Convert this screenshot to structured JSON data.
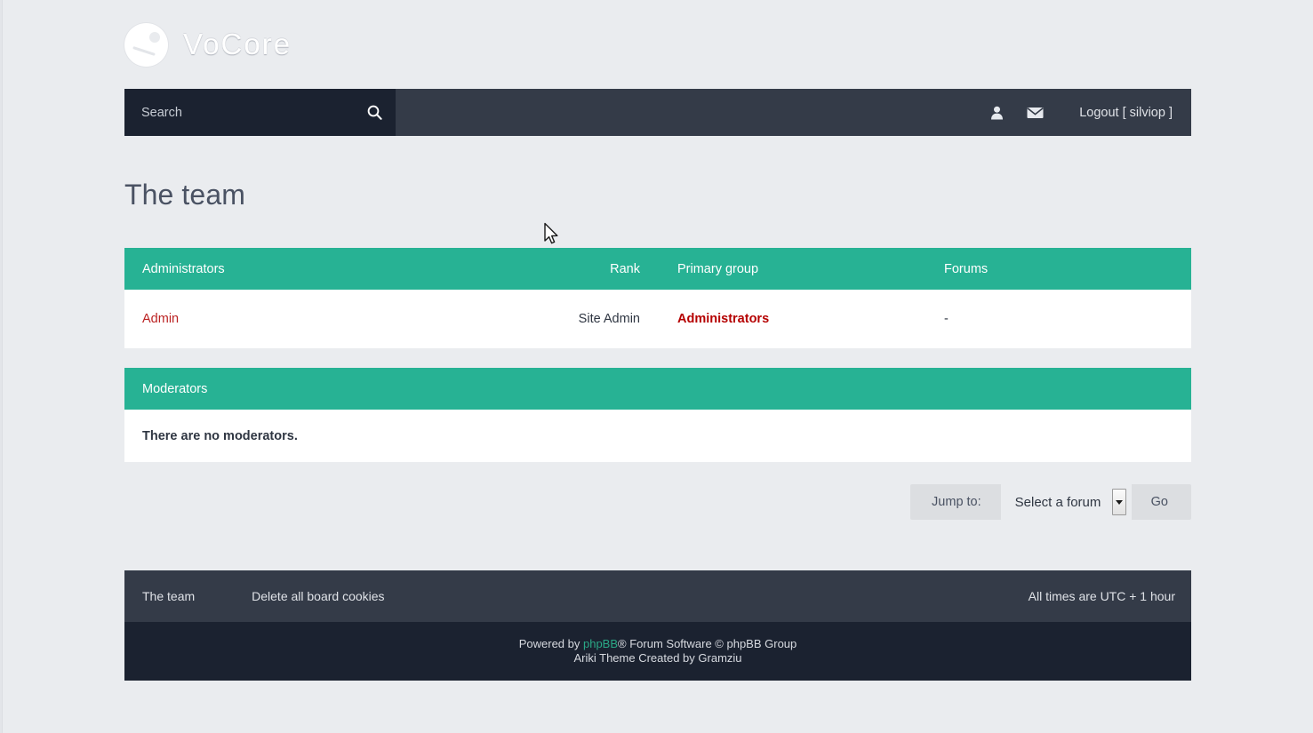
{
  "site": {
    "logo_text": "VoCore",
    "logo_icon": "vocore-circle-logo"
  },
  "navbar": {
    "search_placeholder": "Search",
    "search_value": "",
    "search_icon": "search-icon",
    "profile_icon": "user-icon",
    "messages_icon": "envelope-icon",
    "logout_label": "Logout [ silviop ]"
  },
  "page": {
    "title": "The team"
  },
  "administrators": {
    "headers": {
      "name": "Administrators",
      "rank": "Rank",
      "group": "Primary group",
      "forums": "Forums"
    },
    "rows": [
      {
        "name": "Admin",
        "rank": "Site Admin",
        "group": "Administrators",
        "forums": "-"
      }
    ]
  },
  "moderators": {
    "header": "Moderators",
    "empty_message": "There are no moderators."
  },
  "jumpbox": {
    "label": "Jump to:",
    "selected": "Select a forum",
    "options": [
      "Select a forum"
    ],
    "go_label": "Go",
    "arrow_icon": "chevron-down-icon"
  },
  "footer": {
    "links": [
      {
        "label": "The team"
      },
      {
        "label": "Delete all board cookies"
      }
    ],
    "timezone": "All times are UTC + 1 hour",
    "powered_prefix": "Powered by ",
    "powered_link": "phpBB",
    "powered_suffix": "® Forum Software © phpBB Group",
    "theme_credit": "Ariki Theme Created by Gramziu"
  },
  "colors": {
    "accent_green": "#27b294",
    "navbar_dark": "#343b48",
    "deep_dark": "#1b2230",
    "page_bg": "#eaecef",
    "link_red": "#bb2222",
    "group_red": "#b50000",
    "phpbb_green": "#2aa886"
  }
}
